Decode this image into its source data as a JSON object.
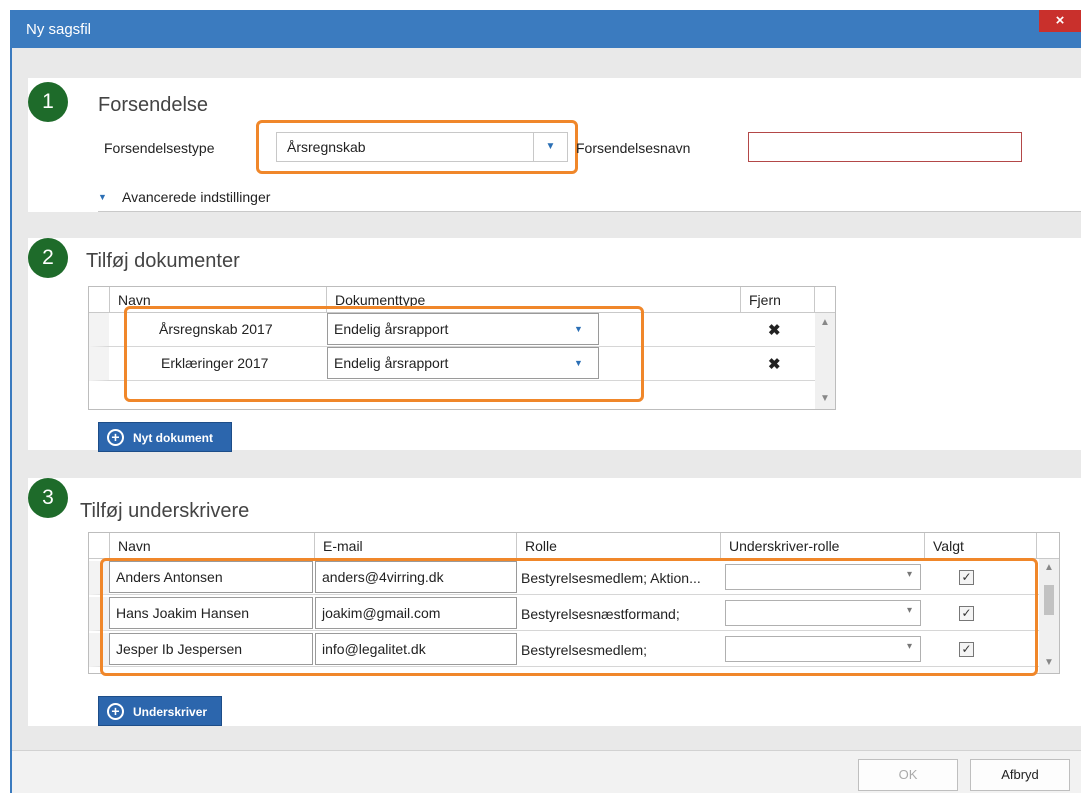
{
  "window": {
    "title": "Ny sagsfil",
    "close": "×"
  },
  "section1": {
    "number": "1",
    "title": "Forsendelse",
    "type_label": "Forsendelsestype",
    "type_value": "Årsregnskab",
    "name_label": "Forsendelsesnavn",
    "name_value": "",
    "advanced": "Avancerede indstillinger",
    "advanced_arrow": "▼"
  },
  "section2": {
    "number": "2",
    "title": "Tilføj dokumenter",
    "columns": {
      "name": "Navn",
      "type": "Dokumenttype",
      "remove": "Fjern"
    },
    "rows": [
      {
        "name": "Årsregnskab 2017",
        "type": "Endelig årsrapport",
        "remove": "✖"
      },
      {
        "name": "Erklæringer 2017",
        "type": "Endelig årsrapport",
        "remove": "✖"
      }
    ],
    "add_button": "Nyt dokument"
  },
  "section3": {
    "number": "3",
    "title": "Tilføj underskrivere",
    "columns": {
      "name": "Navn",
      "email": "E-mail",
      "role": "Rolle",
      "signer_role": "Underskriver-rolle",
      "selected": "Valgt"
    },
    "rows": [
      {
        "name": "Anders Antonsen",
        "email": "anders@4virring.dk",
        "role": "Bestyrelsesmedlem; Aktion...",
        "signer_role": "",
        "selected": "✓"
      },
      {
        "name": "Hans Joakim Hansen",
        "email": "joakim@gmail.com",
        "role": "Bestyrelsesnæstformand;",
        "signer_role": "",
        "selected": "✓"
      },
      {
        "name": "Jesper Ib Jespersen",
        "email": "info@legalitet.dk",
        "role": "Bestyrelsesmedlem;",
        "signer_role": "",
        "selected": "✓"
      }
    ],
    "add_button": "Underskriver"
  },
  "footer": {
    "ok": "OK",
    "cancel": "Afbryd"
  },
  "icons": {
    "dropdown_arrow": "▼",
    "plus": "+",
    "scroll_up": "▲",
    "scroll_down": "▼",
    "small_arrow": "▾"
  },
  "colors": {
    "titlebar": "#3b7bbf",
    "badge": "#1e6b2a",
    "highlight": "#f0872a",
    "button": "#2c66ad",
    "close": "#c9302c"
  }
}
